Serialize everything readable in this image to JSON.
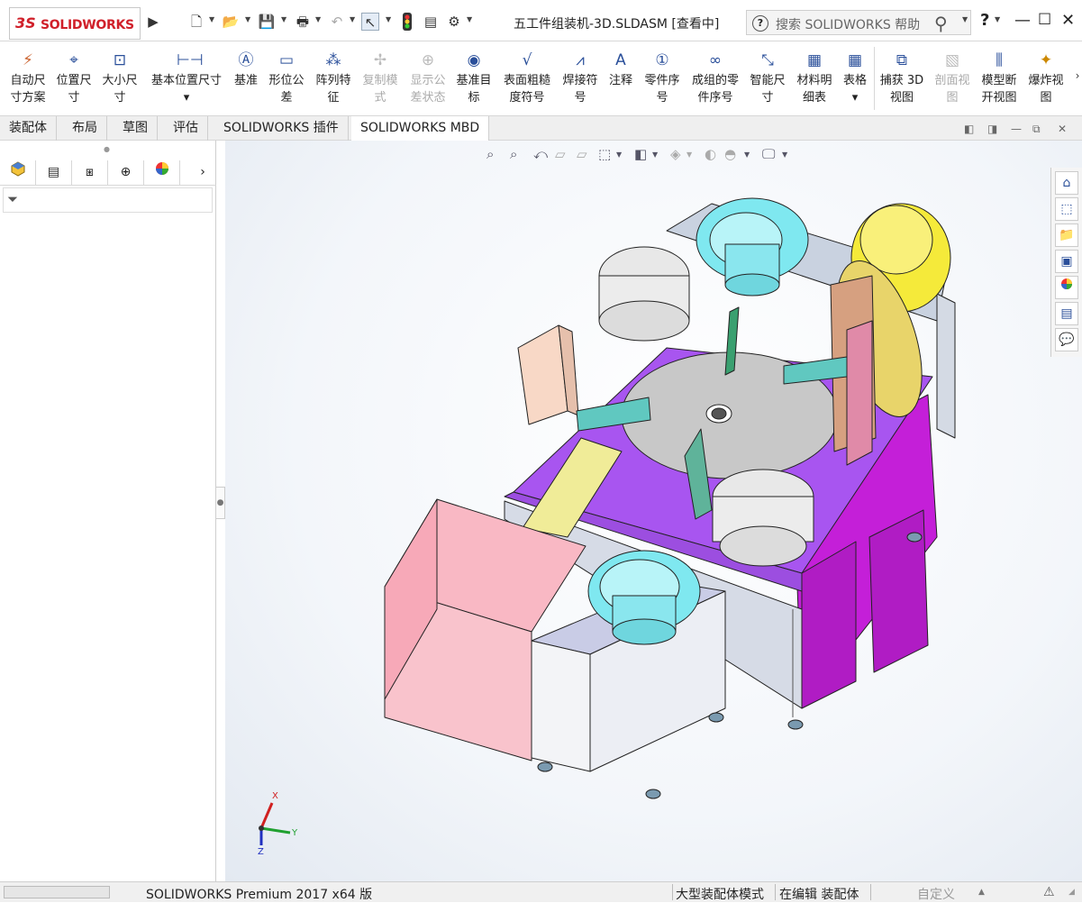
{
  "titlebar": {
    "logo_ds": "3S",
    "logo_text": "SOLIDWORKS",
    "document_title": "五工件组装机-3D.SLDASM [查看中]",
    "help_search_placeholder": "搜索 SOLIDWORKS 帮助",
    "help_label": "?"
  },
  "ribbon": {
    "buttons": [
      {
        "label1": "自动尺",
        "label2": "寸方案"
      },
      {
        "label1": "位置尺",
        "label2": "寸"
      },
      {
        "label1": "大小尺",
        "label2": "寸"
      },
      {
        "label1": "基本位置尺寸",
        "label2": "▾"
      },
      {
        "label1": "基准",
        "label2": ""
      },
      {
        "label1": "形位公",
        "label2": "差"
      },
      {
        "label1": "阵列特",
        "label2": "征"
      },
      {
        "label1": "复制模",
        "label2": "式"
      },
      {
        "label1": "显示公",
        "label2": "差状态"
      },
      {
        "label1": "基准目",
        "label2": "标"
      },
      {
        "label1": "表面粗糙",
        "label2": "度符号"
      },
      {
        "label1": "焊接符",
        "label2": "号"
      },
      {
        "label1": "注释",
        "label2": ""
      },
      {
        "label1": "零件序",
        "label2": "号"
      },
      {
        "label1": "成组的零",
        "label2": "件序号"
      },
      {
        "label1": "智能尺",
        "label2": "寸"
      },
      {
        "label1": "材料明",
        "label2": "细表"
      },
      {
        "label1": "表格",
        "label2": "▾"
      },
      {
        "label1": "捕获 3D",
        "label2": "视图"
      },
      {
        "label1": "剖面视",
        "label2": "图"
      },
      {
        "label1": "模型断",
        "label2": "开视图"
      },
      {
        "label1": "爆炸视",
        "label2": "图"
      }
    ]
  },
  "tabs": [
    {
      "label": "装配体"
    },
    {
      "label": "布局"
    },
    {
      "label": "草图"
    },
    {
      "label": "评估"
    },
    {
      "label": "SOLIDWORKS 插件"
    },
    {
      "label": "SOLIDWORKS MBD"
    }
  ],
  "triad": {
    "x": "X",
    "y": "Y",
    "z": "Z"
  },
  "statusbar": {
    "product": "SOLIDWORKS Premium 2017 x64 版",
    "mode": "大型装配体模式",
    "editing": "在编辑 装配体",
    "units": "自定义"
  },
  "colors": {
    "purple_table": "#a855f0",
    "cyan_bowl": "#7fe8f0",
    "yellow_bowl": "#f5ea3a",
    "pink_bin": "#f9b8c4",
    "frame_gray": "#c9d2e0"
  }
}
